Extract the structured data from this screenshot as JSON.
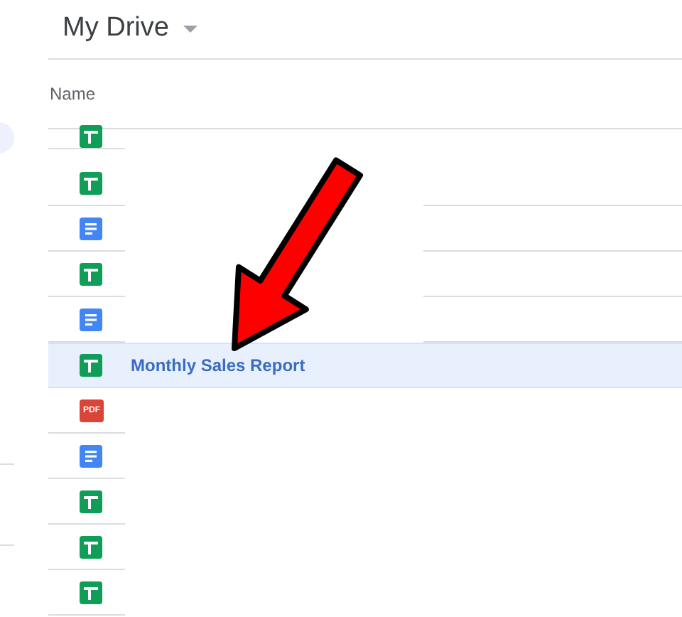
{
  "header": {
    "title": "My Drive"
  },
  "column_header": "Name",
  "files": [
    {
      "kind": "sheet",
      "selected": false
    },
    {
      "kind": "sheet",
      "selected": false
    },
    {
      "kind": "doc",
      "selected": false
    },
    {
      "kind": "sheet",
      "selected": false
    },
    {
      "kind": "doc",
      "selected": false
    },
    {
      "kind": "sheet",
      "selected": true,
      "name": "Monthly Sales Report"
    },
    {
      "kind": "pdf",
      "selected": false,
      "icon_text": "PDF"
    },
    {
      "kind": "doc",
      "selected": false
    },
    {
      "kind": "sheet",
      "selected": false
    },
    {
      "kind": "sheet",
      "selected": false
    },
    {
      "kind": "sheet",
      "selected": false
    }
  ]
}
